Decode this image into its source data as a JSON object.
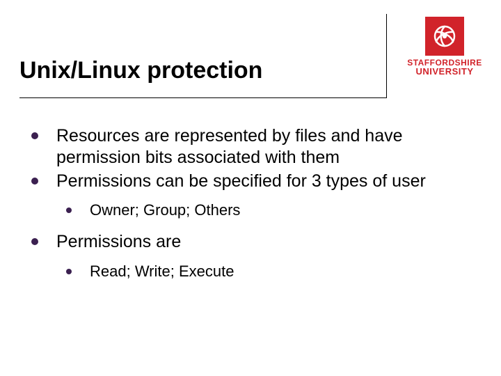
{
  "title": "Unix/Linux protection",
  "logo": {
    "line1": "STAFFORDSHIRE",
    "line2": "UNIVERSITY"
  },
  "bullets": [
    {
      "text": "Resources are represented by files and have permission bits associated with them"
    },
    {
      "text": "Permissions can be specified for 3 types of user",
      "sub": [
        {
          "text": "Owner; Group; Others"
        }
      ]
    },
    {
      "text": "Permissions are",
      "sub": [
        {
          "text": "Read; Write; Execute"
        }
      ]
    }
  ]
}
